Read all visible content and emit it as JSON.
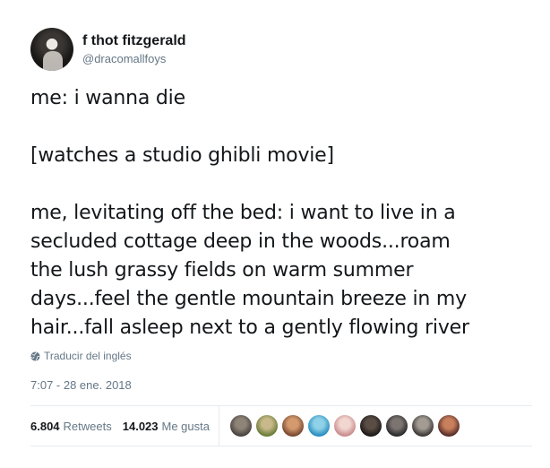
{
  "author": {
    "display_name": "f thot fitzgerald",
    "handle": "@dracomallfoys"
  },
  "tweet": {
    "paragraphs": [
      [
        "me: i wanna die"
      ],
      [
        "[watches a studio ghibli movie]"
      ],
      [
        "me, levitating off the bed: i want to live in a",
        "secluded cottage deep in the woods...roam",
        "the lush grassy fields on warm summer",
        "days...feel the gentle mountain breeze in my",
        "hair...fall asleep next to a gently flowing river"
      ]
    ]
  },
  "translate": {
    "icon": "globe-icon",
    "label": "Traducir del inglés"
  },
  "timestamp": "7:07 - 28 ene. 2018",
  "stats": {
    "retweets_count": "6.804",
    "retweets_label": "Retweets",
    "likes_count": "14.023",
    "likes_label": "Me gusta"
  },
  "liker_avatars": [
    {
      "name": "liker-avatar-1",
      "colors": [
        "#4a4440",
        "#8e8478"
      ]
    },
    {
      "name": "liker-avatar-2",
      "colors": [
        "#6b7d3a",
        "#c9b98a"
      ]
    },
    {
      "name": "liker-avatar-3",
      "colors": [
        "#7a4a32",
        "#d49a6e"
      ]
    },
    {
      "name": "liker-avatar-4",
      "colors": [
        "#2a8fc0",
        "#8fd1e8"
      ]
    },
    {
      "name": "liker-avatar-5",
      "colors": [
        "#c98e8e",
        "#f2d6d0"
      ]
    },
    {
      "name": "liker-avatar-6",
      "colors": [
        "#1e1a1a",
        "#5a4d44"
      ]
    },
    {
      "name": "liker-avatar-7",
      "colors": [
        "#2b2b2e",
        "#7c7470"
      ]
    },
    {
      "name": "liker-avatar-8",
      "colors": [
        "#3e3a38",
        "#a39c94"
      ]
    },
    {
      "name": "liker-avatar-9",
      "colors": [
        "#5a2e2a",
        "#c77f5c"
      ]
    }
  ]
}
